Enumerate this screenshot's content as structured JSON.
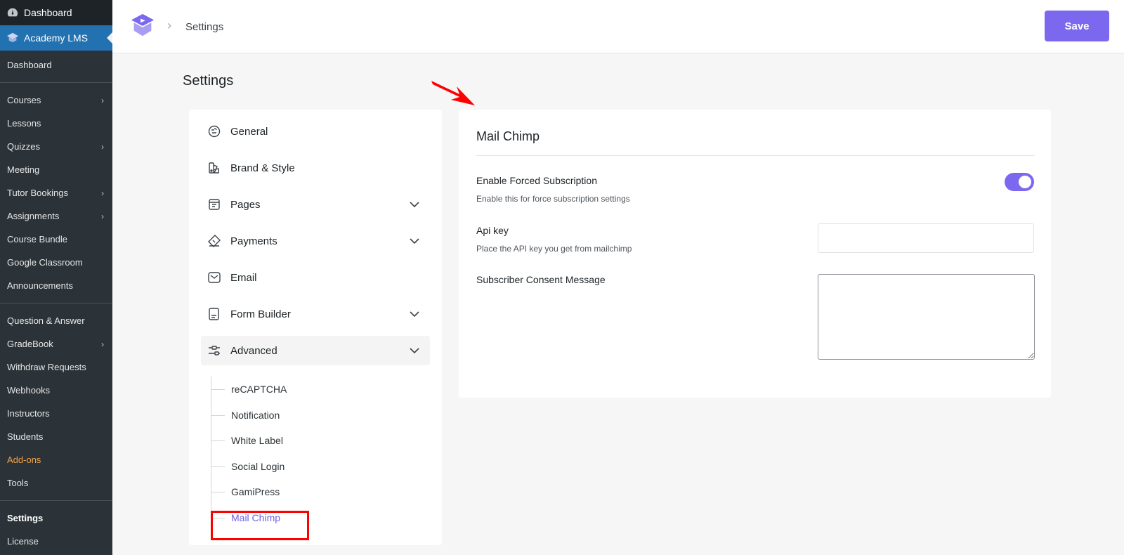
{
  "sidebar": {
    "top_items": [
      {
        "label": "Dashboard",
        "icon": "dashboard-icon"
      },
      {
        "label": "Academy LMS",
        "icon": "academy-logo-icon"
      }
    ],
    "group1": [
      {
        "label": "Dashboard",
        "has_submenu": false
      }
    ],
    "group2": [
      {
        "label": "Courses",
        "has_submenu": true
      },
      {
        "label": "Lessons",
        "has_submenu": false
      },
      {
        "label": "Quizzes",
        "has_submenu": true
      },
      {
        "label": "Meeting",
        "has_submenu": false
      },
      {
        "label": "Tutor Bookings",
        "has_submenu": true
      },
      {
        "label": "Assignments",
        "has_submenu": true
      },
      {
        "label": "Course Bundle",
        "has_submenu": false
      },
      {
        "label": "Google Classroom",
        "has_submenu": false
      },
      {
        "label": "Announcements",
        "has_submenu": false
      }
    ],
    "group3": [
      {
        "label": "Question & Answer",
        "has_submenu": false
      },
      {
        "label": "GradeBook",
        "has_submenu": true
      },
      {
        "label": "Withdraw Requests",
        "has_submenu": false
      },
      {
        "label": "Webhooks",
        "has_submenu": false
      },
      {
        "label": "Instructors",
        "has_submenu": false
      },
      {
        "label": "Students",
        "has_submenu": false
      },
      {
        "label": "Add-ons",
        "has_submenu": false
      },
      {
        "label": "Tools",
        "has_submenu": false
      }
    ],
    "group4": [
      {
        "label": "Settings",
        "has_submenu": false
      },
      {
        "label": "License",
        "has_submenu": false
      }
    ]
  },
  "header": {
    "breadcrumb": "Settings",
    "save_label": "Save"
  },
  "page": {
    "title": "Settings"
  },
  "settings_menu": {
    "items": [
      {
        "label": "General",
        "icon": "general-icon",
        "expandable": false
      },
      {
        "label": "Brand & Style",
        "icon": "brand-style-icon",
        "expandable": false
      },
      {
        "label": "Pages",
        "icon": "pages-icon",
        "expandable": true
      },
      {
        "label": "Payments",
        "icon": "payments-icon",
        "expandable": true
      },
      {
        "label": "Email",
        "icon": "email-icon",
        "expandable": false
      },
      {
        "label": "Form Builder",
        "icon": "form-builder-icon",
        "expandable": true
      },
      {
        "label": "Advanced",
        "icon": "advanced-icon",
        "expandable": true
      }
    ],
    "advanced_submenu": [
      "reCAPTCHA",
      "Notification",
      "White Label",
      "Social Login",
      "GamiPress",
      "Mail Chimp"
    ],
    "active_sub": "Mail Chimp"
  },
  "mailchimp": {
    "title": "Mail Chimp",
    "forced_subscription": {
      "label": "Enable Forced Subscription",
      "help": "Enable this for force subscription settings",
      "enabled": true
    },
    "api_key": {
      "label": "Api key",
      "help": "Place the API key you get from mailchimp",
      "value": ""
    },
    "consent": {
      "label": "Subscriber Consent Message",
      "value": ""
    }
  },
  "colors": {
    "accent": "#7b68ee",
    "wp_sidebar": "#2c3338",
    "wp_active": "#2271b1",
    "annotation_red": "#ff0000",
    "addons_orange": "#f0a24a"
  }
}
